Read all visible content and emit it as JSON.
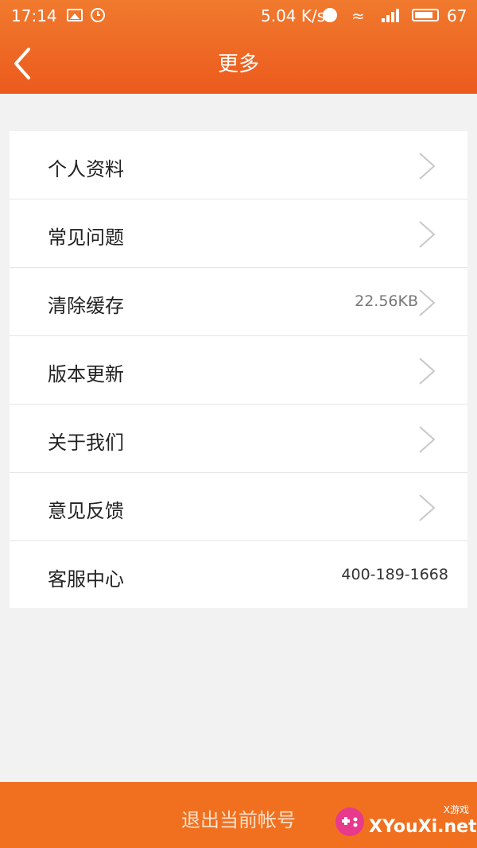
{
  "status_bar": {
    "time": "17:14",
    "speed": "5.04 K/s",
    "battery": "67",
    "icons": [
      "image-icon",
      "clock-icon",
      "alarm-icon",
      "wifi-icon",
      "signal-icon",
      "battery-icon"
    ]
  },
  "header": {
    "title": "更多",
    "back_icon": "chevron-left-icon"
  },
  "menu": {
    "items": [
      {
        "label": "个人资料",
        "value": "",
        "chevron": true
      },
      {
        "label": "常见问题",
        "value": "",
        "chevron": true
      },
      {
        "label": "清除缓存",
        "value": "22.56KB",
        "chevron": true
      },
      {
        "label": "版本更新",
        "value": "",
        "chevron": true
      },
      {
        "label": "关于我们",
        "value": "",
        "chevron": true
      },
      {
        "label": "意见反馈",
        "value": "",
        "chevron": true
      },
      {
        "label": "客服中心",
        "value": "400-189-1668",
        "chevron": false
      }
    ]
  },
  "footer": {
    "logout_label": "退出当前帐号"
  },
  "watermark": {
    "site": "XYouXi.net",
    "tag": "X游戏"
  },
  "colors": {
    "accent": "#f07020",
    "background": "#f2f2f2"
  }
}
